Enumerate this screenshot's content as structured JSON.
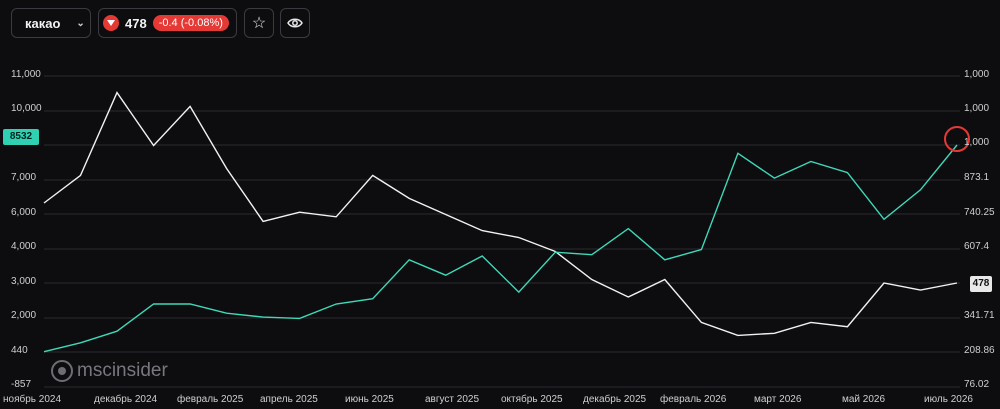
{
  "toolbar": {
    "ticker": "какао",
    "price": "478",
    "change": "-0.4 (-0.08%)",
    "star_icon": "star-icon",
    "eye_icon": "eye-icon",
    "dropdown_icon": "chevron-down-icon"
  },
  "logo": {
    "text": "mscinsider"
  },
  "badges": {
    "left_value": "8532",
    "right_value": "478"
  },
  "colors": {
    "background": "#0d0d10",
    "white_series": "#f2f2f2",
    "teal_series": "#3fd8b8",
    "marker": "#e53935"
  },
  "chart_data": {
    "type": "line",
    "x_labels": [
      "ноябрь 2024",
      "декабрь 2024",
      "февраль 2025",
      "апрель 2025",
      "июнь 2025",
      "август 2025",
      "октябрь 2025",
      "декабрь 2025",
      "февраль 2026",
      "март 2026",
      "май 2026",
      "июль 2026"
    ],
    "left_axis": {
      "ticks": [
        "11,000",
        "10,000",
        "7,000",
        "6,000",
        "4,000",
        "3,000",
        "2,000",
        "440",
        "-857"
      ]
    },
    "right_axis": {
      "ticks": [
        "1,000",
        "1,000",
        "1,000",
        "873.1",
        "740.25",
        "607.4",
        "341.71",
        "208.86",
        "76.02"
      ]
    },
    "grid": true,
    "series": [
      {
        "color": "#f2f2f2",
        "axis": "left",
        "values": [
          6000,
          7200,
          10800,
          8500,
          10200,
          7500,
          5200,
          5600,
          5400,
          7200,
          6200,
          5500,
          4800,
          4500,
          3900,
          3100,
          2600,
          3100,
          1800,
          1200,
          1300,
          1800,
          1600,
          3000,
          2800,
          3000
        ]
      },
      {
        "color": "#3fd8b8",
        "axis": "right",
        "values": [
          210,
          245,
          290,
          395,
          395,
          360,
          345,
          340,
          395,
          415,
          565,
          505,
          580,
          440,
          595,
          585,
          685,
          565,
          605,
          970,
          880,
          940,
          900,
          720,
          835,
          1000
        ]
      }
    ]
  }
}
